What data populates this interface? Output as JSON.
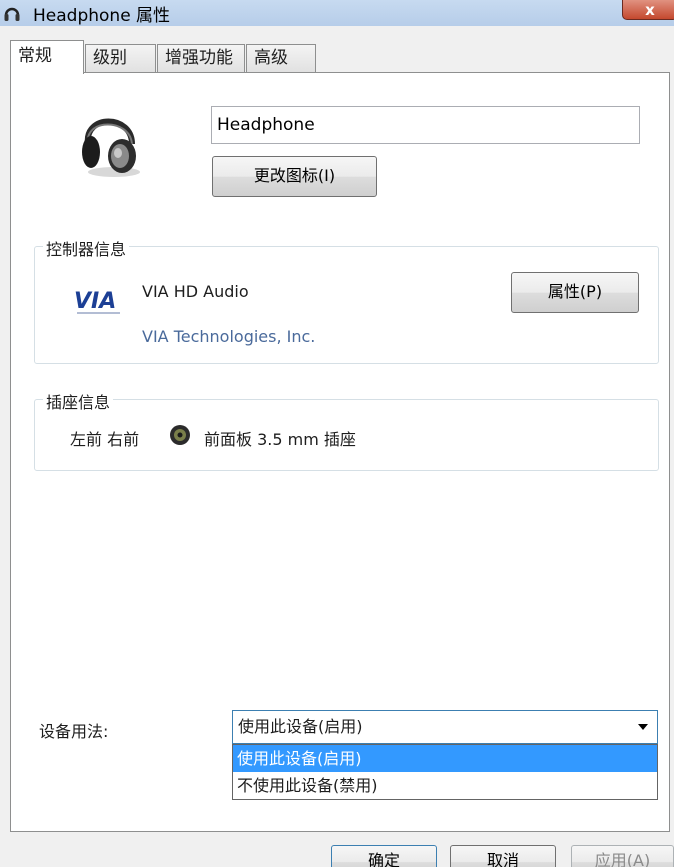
{
  "window": {
    "title": "Headphone 属性",
    "close_label": "x"
  },
  "tabs": [
    {
      "label": "常规",
      "active": true
    },
    {
      "label": "级别",
      "active": false
    },
    {
      "label": "增强功能",
      "active": false
    },
    {
      "label": "高级",
      "active": false
    }
  ],
  "general": {
    "device_name": "Headphone",
    "change_icon_label": "更改图标(I)",
    "controller": {
      "legend": "控制器信息",
      "name": "VIA HD Audio",
      "vendor": "VIA Technologies, Inc.",
      "properties_label": "属性(P)",
      "logo_text": "VIA"
    },
    "jack": {
      "legend": "插座信息",
      "position": "左前 右前",
      "description": "前面板 3.5 mm 插座"
    },
    "usage": {
      "label": "设备用法:",
      "selected": "使用此设备(启用)",
      "options": [
        "使用此设备(启用)",
        "不使用此设备(禁用)"
      ]
    }
  },
  "footer": {
    "ok_label": "确定",
    "cancel_label": "取消",
    "apply_label": "应用(A)"
  }
}
